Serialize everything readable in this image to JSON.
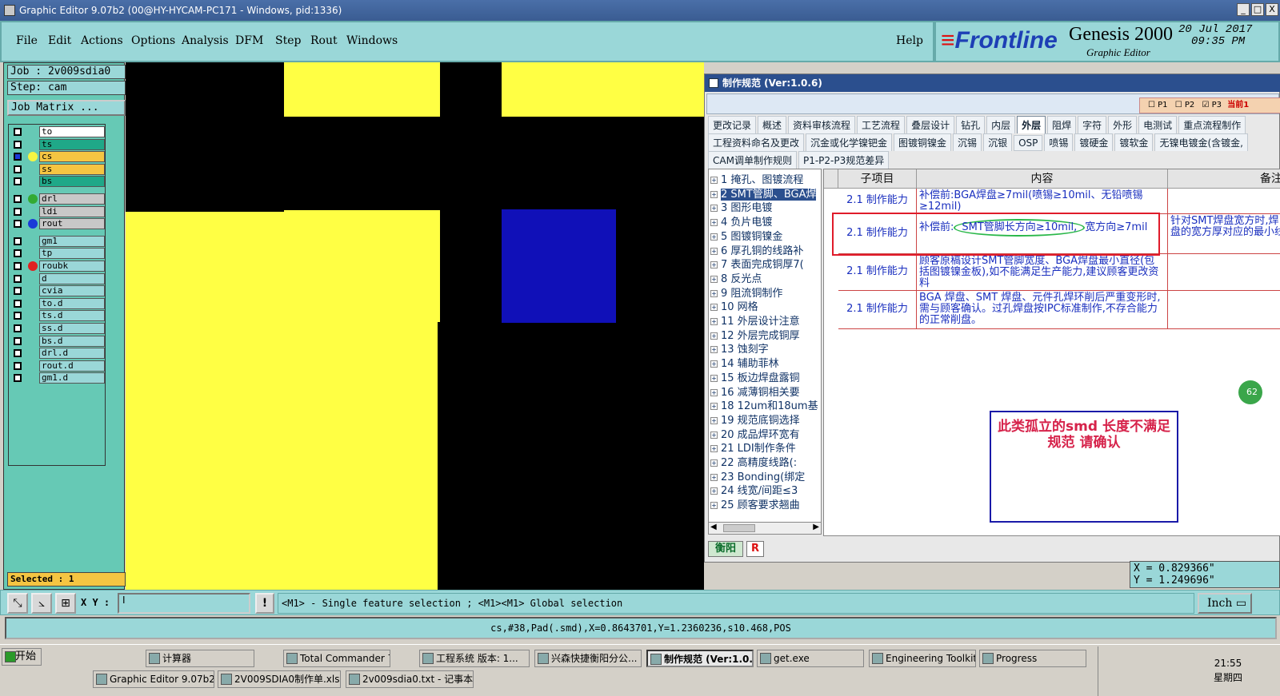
{
  "window": {
    "title": "Graphic Editor 9.07b2 (00@HY-HYCAM-PC171 - Windows, pid:1336)",
    "btn_min": "_",
    "btn_max": "□",
    "btn_close": "X"
  },
  "menu": {
    "file": "File",
    "edit": "Edit",
    "actions": "Actions",
    "options": "Options",
    "analysis": "Analysis",
    "dfm": "DFM",
    "step": "Step",
    "rout": "Rout",
    "windows": "Windows",
    "help": "Help"
  },
  "brand": {
    "logo": "Frontline",
    "product": "Genesis 2000",
    "subtitle": "Graphic Editor",
    "date": "20 Jul 2017",
    "time": "09:35 PM"
  },
  "left": {
    "job": "Job : 2v009sdia0",
    "step": "Step: cam",
    "job_matrix": "Job Matrix ...",
    "selected": "Selected : 1"
  },
  "layers": [
    {
      "name": "to",
      "color": "#ffffff"
    },
    {
      "name": "ts",
      "color": "#1fa888"
    },
    {
      "name": "cs",
      "color": "#f5c542",
      "dot": "#f5f542",
      "active": true
    },
    {
      "name": "ss",
      "color": "#f5c542"
    },
    {
      "name": "bs",
      "color": "#1fa888"
    },
    {
      "name": "drl",
      "color": "#c8c8c8",
      "dot": "#33aa33"
    },
    {
      "name": "ldi",
      "color": "#c8c8c8"
    },
    {
      "name": "rout",
      "color": "#c8c8c8",
      "dot": "#1a3ad8"
    },
    {
      "name": "gm1",
      "color": "#9ad7d8"
    },
    {
      "name": "tp",
      "color": "#9ad7d8"
    },
    {
      "name": "roubk",
      "color": "#9ad7d8",
      "dot": "#e02020"
    },
    {
      "name": "d",
      "color": "#9ad7d8"
    },
    {
      "name": "cvia",
      "color": "#9ad7d8"
    },
    {
      "name": "to.d",
      "color": "#9ad7d8"
    },
    {
      "name": "ts.d",
      "color": "#9ad7d8"
    },
    {
      "name": "ss.d",
      "color": "#9ad7d8"
    },
    {
      "name": "bs.d",
      "color": "#9ad7d8"
    },
    {
      "name": "drl.d",
      "color": "#9ad7d8"
    },
    {
      "name": "rout.d",
      "color": "#9ad7d8"
    },
    {
      "name": "gm1.d",
      "color": "#9ad7d8"
    }
  ],
  "dialog": {
    "title": "制作规范 (Ver:1.0.6)",
    "p_options": {
      "p1": "P1",
      "p2": "P2",
      "p3": "P3",
      "current": "当前1"
    },
    "tabs_row1": [
      "更改记录",
      "概述",
      "资料审核流程",
      "工艺流程",
      "叠层设计",
      "钻孔",
      "内层",
      "外层",
      "阻焊",
      "字符",
      "外形",
      "电测试",
      "重点流程制作"
    ],
    "active_tab": "外层",
    "tabs_row2": [
      "工程资料命名及更改",
      "沉金或化学镍钯金",
      "图镀铜镍金",
      "沉锡",
      "沉银",
      "OSP",
      "喷锡",
      "镀硬金",
      "镀软金",
      "无镍电镀金(含镀金,"
    ],
    "tabs_row3": [
      "CAM调单制作规则",
      "P1-P2-P3规范差异"
    ],
    "tree": [
      "1 掩孔、图镀流程",
      "2 SMT管脚、BGA焊",
      "3 图形电镀",
      "4 负片电镀",
      "5 图镀铜镍金",
      "6 厚孔铜的线路补",
      "7 表面完成铜厚7(",
      "8 反光点",
      "9 阻流铜制作",
      "10 网格",
      "11 外层设计注意",
      "12 外层完成铜厚",
      "13 蚀刻字",
      "14 辅助菲林",
      "15 板边焊盘露铜",
      "16 减薄铜相关要",
      "18 12um和18um基",
      "19 规范底铜选择",
      "20 成品焊环宽有",
      "21 LDI制作条件",
      "22 高精度线路(:",
      "23 Bonding(绑定",
      "24 线宽/间距≤3",
      "25 顾客要求翘曲"
    ],
    "selected_tree_index": 1,
    "grid_headers": {
      "sub": "子项目",
      "content": "内容",
      "note": "备注"
    },
    "rows": [
      {
        "sub": "2.1 制作能力",
        "content": "补偿前:BGA焊盘≥7mil(喷锡≥10mil、无铅喷锡≥12mil)",
        "note": ""
      },
      {
        "sub": "2.1 制作能力",
        "content_a": "补偿前:",
        "content_b": "SMT管脚长方向≥10mil,",
        "content_c": "宽方向≥7mil",
        "note": "针对SMT焊盘宽方时,焊盘的宽方厚对应的最小线"
      },
      {
        "sub": "2.1 制作能力",
        "content": "顾客原稿设计SMT管脚宽度、BGA焊盘最小直径(包括图镀镍金板),如不能满足生产能力,建议顾客更改资料",
        "note": ""
      },
      {
        "sub": "2.1 制作能力",
        "content": "BGA 焊盘、SMT 焊盘、元件孔焊环削后严重变形时,需与顾客确认。过孔焊盘按IPC标准制作,不存合能力的正常削盘。",
        "note": ""
      }
    ],
    "annotation": "此类孤立的smd 长度不满足规范  请确认",
    "bottom_tab1": "衡阳",
    "bottom_tab2": "R"
  },
  "side_badge": "62",
  "coords": {
    "x": "X = 0.829366\"",
    "y": "Y = 1.249696\""
  },
  "cmd": {
    "xy_label": "X Y :",
    "xy_value": "I",
    "warn": "!",
    "hint": "<M1> - Single feature selection ; <M1><M1> Global selection",
    "unit": "Inch"
  },
  "status": "cs,#38,Pad(.smd),X=0.8643701,Y=1.2360236,s10.468,POS",
  "taskbar": {
    "start": "开始",
    "row1": [
      "计算器",
      "Total Commander 7....",
      "工程系统 版本: 1...",
      "兴森快捷衡阳分公...",
      "制作规范 (Ver:1.0....",
      "get.exe",
      "Engineering Toolkit 9...",
      "Progress"
    ],
    "row2": [
      "Graphic Editor 9.07b2 (0...",
      "2V009SDIA0制作单.xls",
      "2v009sdia0.txt - 记事本"
    ],
    "time": "21:55",
    "day": "星期四"
  }
}
